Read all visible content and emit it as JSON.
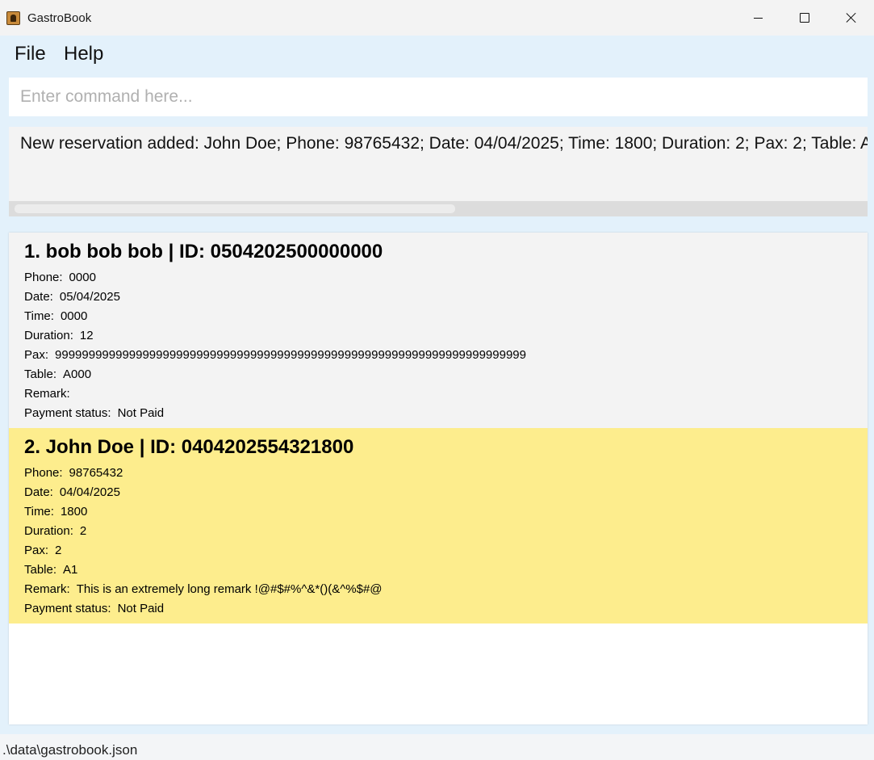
{
  "window": {
    "title": "GastroBook",
    "icon": "address-book-icon"
  },
  "menu": {
    "file": "File",
    "help": "Help"
  },
  "command": {
    "value": "",
    "placeholder": "Enter command here..."
  },
  "result": {
    "text": "New reservation added: John Doe; Phone: 98765432; Date: 04/04/2025; Time: 1800; Duration: 2; Pax: 2; Table: A"
  },
  "reservations": [
    {
      "title": "1. bob bob bob | ID: 0504202500000000",
      "fields": [
        {
          "label": "Phone:",
          "value": "0000"
        },
        {
          "label": "Date:",
          "value": "05/04/2025"
        },
        {
          "label": "Time:",
          "value": "0000"
        },
        {
          "label": "Duration:",
          "value": "12"
        },
        {
          "label": "Pax:",
          "value": "9999999999999999999999999999999999999999999999999999999999999999999999"
        },
        {
          "label": "Table:",
          "value": "A000"
        },
        {
          "label": "Remark:",
          "value": ""
        },
        {
          "label": "Payment status:",
          "value": "Not Paid"
        }
      ],
      "background": "#f3f3f3"
    },
    {
      "title": "2. John Doe | ID: 0404202554321800",
      "fields": [
        {
          "label": "Phone:",
          "value": "98765432"
        },
        {
          "label": "Date:",
          "value": "04/04/2025"
        },
        {
          "label": "Time:",
          "value": "1800"
        },
        {
          "label": "Duration:",
          "value": "2"
        },
        {
          "label": "Pax:",
          "value": "2"
        },
        {
          "label": "Table:",
          "value": "A1"
        },
        {
          "label": "Remark:",
          "value": "This is an extremely long remark !@#$#%^&*()(&^%$#@"
        },
        {
          "label": "Payment status:",
          "value": "Not Paid"
        }
      ],
      "background": "#fded8d"
    }
  ],
  "status": {
    "file_path": ".\\data\\gastrobook.json"
  }
}
